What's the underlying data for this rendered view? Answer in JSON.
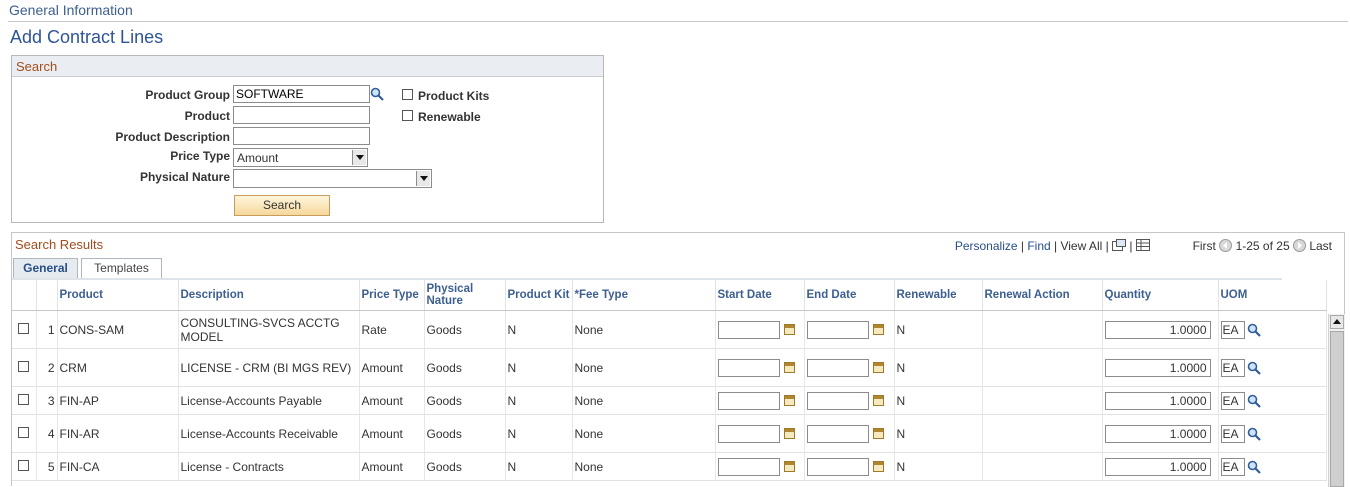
{
  "header": {
    "section": "General Information",
    "title": "Add Contract Lines"
  },
  "search": {
    "title": "Search",
    "product_group_label": "Product Group",
    "product_group_value": "SOFTWARE",
    "product_label": "Product",
    "product_value": "",
    "description_label": "Product Description",
    "description_value": "",
    "price_type_label": "Price Type",
    "price_type_value": "Amount",
    "physical_nature_label": "Physical Nature",
    "physical_nature_value": "",
    "product_kits_label": "Product Kits",
    "renewable_label": "Renewable",
    "search_button": "Search"
  },
  "results": {
    "title": "Search Results",
    "personalize": "Personalize",
    "find": "Find",
    "view_all": "View All",
    "first": "First",
    "range": "1-25 of 25",
    "last": "Last",
    "tabs": [
      "General",
      "Templates"
    ],
    "columns": [
      "Product",
      "Description",
      "Price Type",
      "Physical Nature",
      "Product Kit",
      "*Fee Type",
      "Start Date",
      "End Date",
      "Renewable",
      "Renewal Action",
      "Quantity",
      "UOM"
    ],
    "rows": [
      {
        "num": "1",
        "product": "CONS-SAM",
        "description": "CONSULTING-SVCS ACCTG MODEL",
        "price_type": "Rate",
        "nature": "Goods",
        "kit": "N",
        "fee_type": "None",
        "renewable": "N",
        "quantity": "1.0000",
        "uom": "EA"
      },
      {
        "num": "2",
        "product": "CRM",
        "description": "LICENSE - CRM (BI MGS REV)",
        "price_type": "Amount",
        "nature": "Goods",
        "kit": "N",
        "fee_type": "None",
        "renewable": "N",
        "quantity": "1.0000",
        "uom": "EA"
      },
      {
        "num": "3",
        "product": "FIN-AP",
        "description": "License-Accounts Payable",
        "price_type": "Amount",
        "nature": "Goods",
        "kit": "N",
        "fee_type": "None",
        "renewable": "N",
        "quantity": "1.0000",
        "uom": "EA"
      },
      {
        "num": "4",
        "product": "FIN-AR",
        "description": "License-Accounts Receivable",
        "price_type": "Amount",
        "nature": "Goods",
        "kit": "N",
        "fee_type": "None",
        "renewable": "N",
        "quantity": "1.0000",
        "uom": "EA"
      },
      {
        "num": "5",
        "product": "FIN-CA",
        "description": "License - Contracts",
        "price_type": "Amount",
        "nature": "Goods",
        "kit": "N",
        "fee_type": "None",
        "renewable": "N",
        "quantity": "1.0000",
        "uom": "EA"
      }
    ]
  },
  "icons": [
    "search-icon",
    "calendar-icon",
    "lookup-icon",
    "new-window-icon",
    "download-grid-icon",
    "prev-arrow-icon",
    "next-arrow-icon"
  ]
}
